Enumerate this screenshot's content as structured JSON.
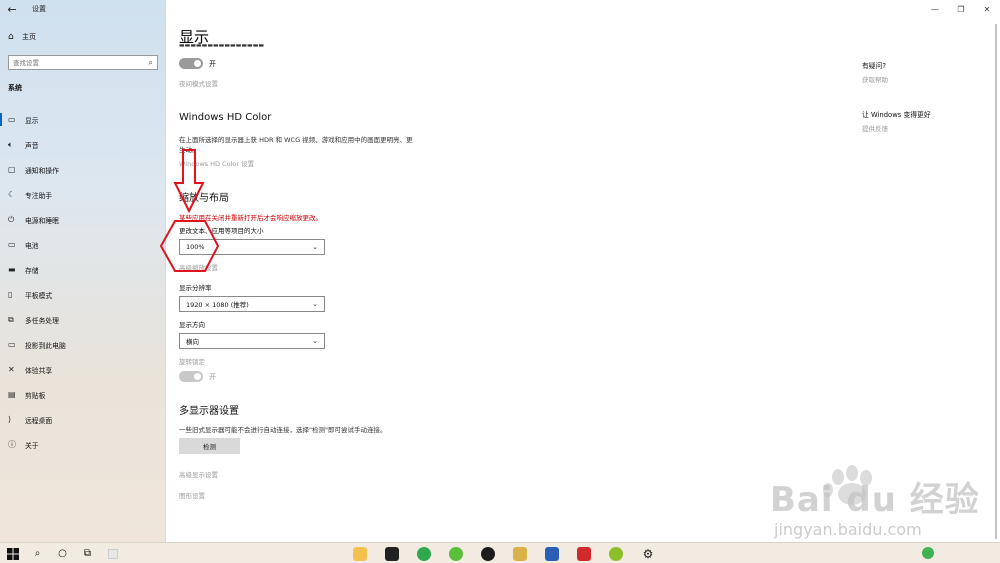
{
  "window": {
    "title": "设置",
    "back_glyph": "←",
    "controls": {
      "minimize": "—",
      "restore": "❐",
      "close": "✕"
    }
  },
  "sidebar": {
    "home_label": "主页",
    "search_placeholder": "查找设置",
    "section": "系统",
    "items": [
      {
        "label": "显示",
        "icon": "monitor-icon"
      },
      {
        "label": "声音",
        "icon": "speaker-icon"
      },
      {
        "label": "通知和操作",
        "icon": "notification-icon"
      },
      {
        "label": "专注助手",
        "icon": "moon-icon"
      },
      {
        "label": "电源和睡眠",
        "icon": "power-icon"
      },
      {
        "label": "电池",
        "icon": "battery-icon"
      },
      {
        "label": "存储",
        "icon": "storage-icon"
      },
      {
        "label": "平板模式",
        "icon": "tablet-icon"
      },
      {
        "label": "多任务处理",
        "icon": "multitask-icon"
      },
      {
        "label": "投影到此电脑",
        "icon": "projection-icon"
      },
      {
        "label": "体验共享",
        "icon": "share-icon"
      },
      {
        "label": "剪贴板",
        "icon": "clipboard-icon"
      },
      {
        "label": "远程桌面",
        "icon": "remote-desktop-icon"
      },
      {
        "label": "关于",
        "icon": "info-icon"
      }
    ]
  },
  "main": {
    "title": "显示",
    "night_light": {
      "state_label": "开",
      "settings_link": "夜间模式设置"
    },
    "hd_color": {
      "heading": "Windows HD Color",
      "description": "在上面所选择的显示器上获 HDR 和 WCG 视频、游戏和应用中的画面更明亮、更生动。",
      "settings_link": "Windows HD Color 设置"
    },
    "scale_layout": {
      "heading": "缩放与布局",
      "warning": "某些应用在关闭并重新打开后才会响应缩放更改。",
      "scale_label": "更改文本、应用等项目的大小",
      "scale_value": "100%",
      "advanced_scale_link": "高级缩放设置",
      "resolution_label": "显示分辨率",
      "resolution_value": "1920 × 1080 (推荐)",
      "orientation_label": "显示方向",
      "orientation_value": "横向",
      "rotation_lock_label": "旋转锁定",
      "rotation_lock_state": "开"
    },
    "multi_display": {
      "heading": "多显示器设置",
      "description": "一些旧式显示器可能不会进行自动连接，选择\"检测\"即可尝试手动连接。",
      "detect_button": "检测",
      "advanced_link": "高级显示设置",
      "graphics_link": "图形设置"
    }
  },
  "help": {
    "question_title": "有疑问?",
    "get_help_link": "获取帮助",
    "improve_title": "让 Windows 变得更好",
    "feedback_link": "提供反馈"
  },
  "watermark": {
    "brand": "Bai du 经验",
    "url": "jingyan.baidu.com"
  },
  "colors": {
    "annotation_red": "#e0141e",
    "warning_red": "#d00000",
    "accent_blue": "#0a64c8"
  }
}
